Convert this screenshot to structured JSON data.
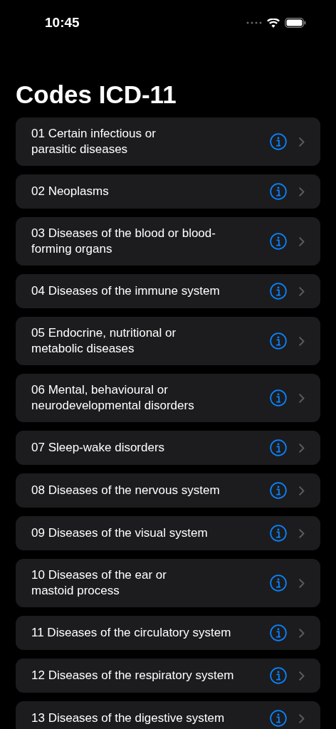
{
  "status_bar": {
    "time": "10:45"
  },
  "title": "Codes ICD-11",
  "chapters": [
    {
      "label": "01 Certain infectious or\nparasitic diseases"
    },
    {
      "label": "02 Neoplasms"
    },
    {
      "label": "03 Diseases of the blood or blood-\nforming organs"
    },
    {
      "label": "04 Diseases of the immune system"
    },
    {
      "label": "05 Endocrine, nutritional or\nmetabolic diseases"
    },
    {
      "label": "06 Mental, behavioural or\nneurodevelopmental disorders"
    },
    {
      "label": "07 Sleep-wake disorders"
    },
    {
      "label": "08 Diseases of the nervous system"
    },
    {
      "label": "09 Diseases of the visual system"
    },
    {
      "label": "10 Diseases of the ear or\nmastoid process"
    },
    {
      "label": "11 Diseases of the circulatory system"
    },
    {
      "label": "12 Diseases of the respiratory system"
    },
    {
      "label": "13 Diseases of the digestive system"
    }
  ]
}
